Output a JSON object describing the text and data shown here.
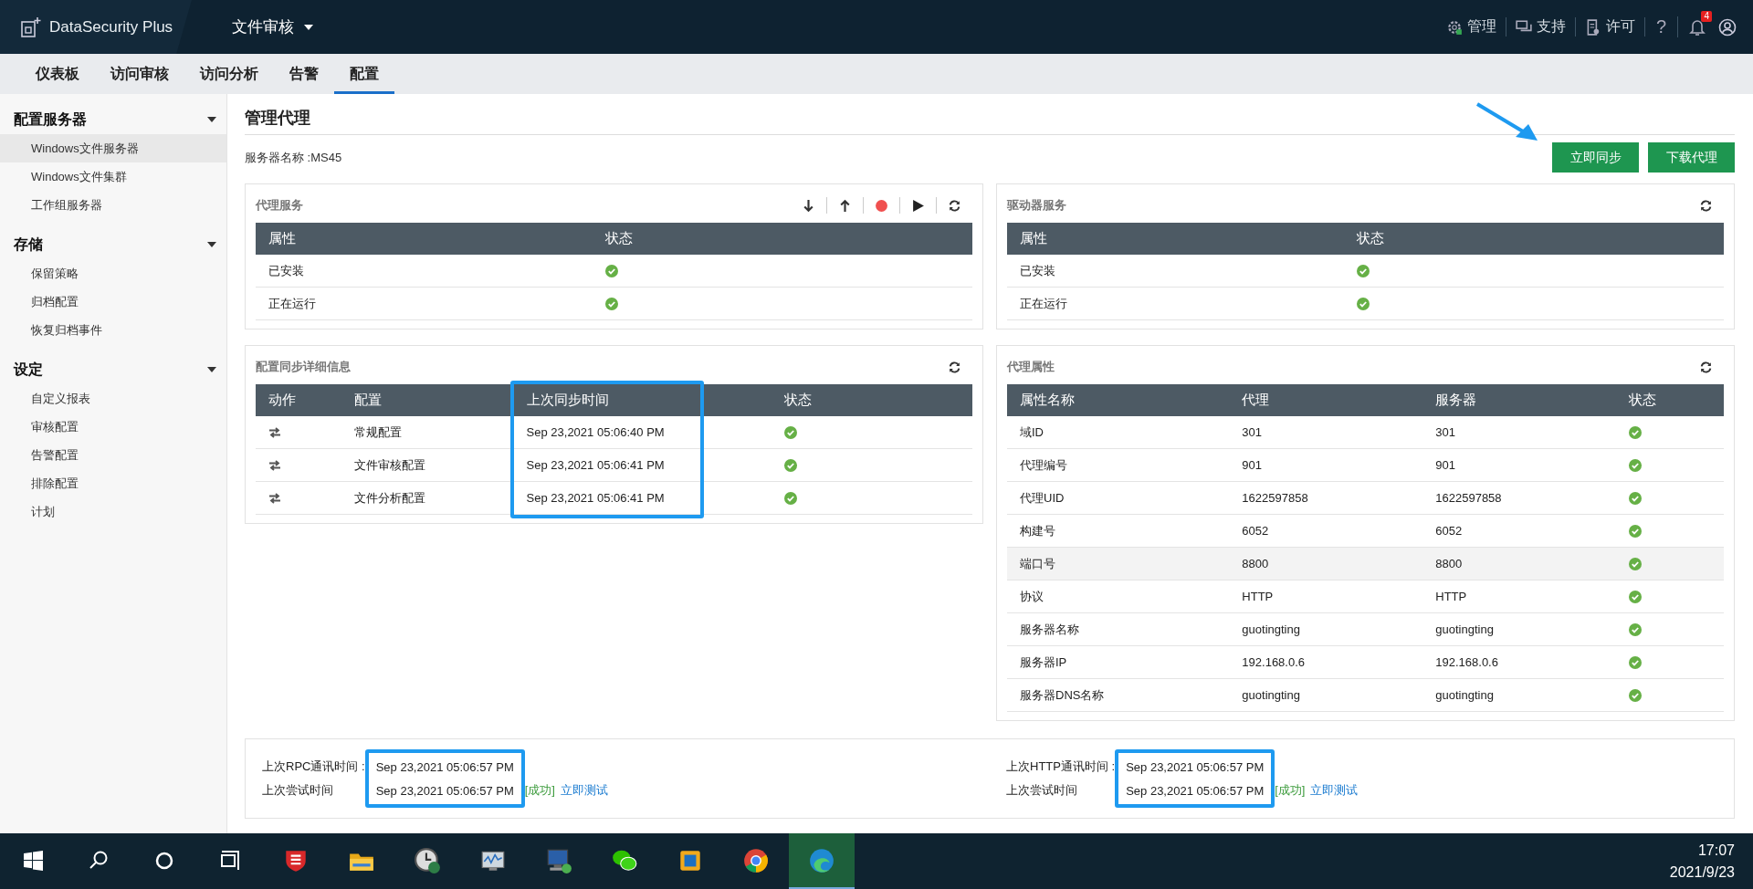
{
  "header": {
    "product": "DataSecurity Plus",
    "module": "文件审核",
    "links": [
      {
        "kind": "gear",
        "label": "管理"
      },
      {
        "kind": "chat",
        "label": "支持"
      },
      {
        "kind": "license",
        "label": "许可"
      }
    ],
    "help": "?",
    "notification_count": "4"
  },
  "tabs": [
    {
      "label": "仪表板",
      "selected": false
    },
    {
      "label": "访问审核",
      "selected": false
    },
    {
      "label": "访问分析",
      "selected": false
    },
    {
      "label": "告警",
      "selected": false
    },
    {
      "label": "配置",
      "selected": true
    }
  ],
  "sidebar": {
    "sections": [
      {
        "title": "配置服务器",
        "items": [
          {
            "label": "Windows文件服务器",
            "selected": true
          },
          {
            "label": "Windows文件集群",
            "selected": false
          },
          {
            "label": "工作组服务器",
            "selected": false
          }
        ]
      },
      {
        "title": "存储",
        "items": [
          {
            "label": "保留策略",
            "selected": false
          },
          {
            "label": "归档配置",
            "selected": false
          },
          {
            "label": "恢复归档事件",
            "selected": false
          }
        ]
      },
      {
        "title": "设定",
        "items": [
          {
            "label": "自定义报表",
            "selected": false
          },
          {
            "label": "审核配置",
            "selected": false
          },
          {
            "label": "告警配置",
            "selected": false
          },
          {
            "label": "排除配置",
            "selected": false
          },
          {
            "label": "计划",
            "selected": false
          }
        ]
      }
    ]
  },
  "page": {
    "title": "管理代理",
    "server_name": "服务器名称 :MS45",
    "buttons": [
      "立即同步",
      "下载代理"
    ]
  },
  "agent_service": {
    "title": "代理服务",
    "columns": [
      "属性",
      "状态"
    ],
    "rows": [
      {
        "name": "已安装",
        "ok": true
      },
      {
        "name": "正在运行",
        "ok": true
      }
    ]
  },
  "sync_details": {
    "title": "配置同步详细信息",
    "columns": [
      "动作",
      "配置",
      "上次同步时间",
      "状态"
    ],
    "rows": [
      {
        "config": "常规配置",
        "time": "Sep 23,2021 05:06:40 PM",
        "ok": true
      },
      {
        "config": "文件审核配置",
        "time": "Sep 23,2021 05:06:41 PM",
        "ok": true
      },
      {
        "config": "文件分析配置",
        "time": "Sep 23,2021 05:06:41 PM",
        "ok": true
      }
    ]
  },
  "driver_service": {
    "title": "驱动器服务",
    "columns": [
      "属性",
      "状态"
    ],
    "rows": [
      {
        "name": "已安装",
        "ok": true
      },
      {
        "name": "正在运行",
        "ok": true
      }
    ]
  },
  "agent_properties": {
    "title": "代理属性",
    "columns": [
      "属性名称",
      "代理",
      "服务器",
      "状态"
    ],
    "rows": [
      {
        "name": "域ID",
        "agent": "301",
        "server": "301",
        "ok": true,
        "selected": false
      },
      {
        "name": "代理编号",
        "agent": "901",
        "server": "901",
        "ok": true,
        "selected": false
      },
      {
        "name": "代理UID",
        "agent": "1622597858",
        "server": "1622597858",
        "ok": true,
        "selected": false
      },
      {
        "name": "构建号",
        "agent": "6052",
        "server": "6052",
        "ok": true,
        "selected": false
      },
      {
        "name": "端口号",
        "agent": "8800",
        "server": "8800",
        "ok": true,
        "selected": true
      },
      {
        "name": "协议",
        "agent": "HTTP",
        "server": "HTTP",
        "ok": true,
        "selected": false
      },
      {
        "name": "服务器名称",
        "agent": "guotingting",
        "server": "guotingting",
        "ok": true,
        "selected": false
      },
      {
        "name": "服务器IP",
        "agent": "192.168.0.6",
        "server": "192.168.0.6",
        "ok": true,
        "selected": false
      },
      {
        "name": "服务器DNS名称",
        "agent": "guotingting",
        "server": "guotingting",
        "ok": true,
        "selected": false
      }
    ]
  },
  "communication": [
    {
      "label": "上次RPC通讯时间 :",
      "time": "Sep 23,2021 05:06:57 PM",
      "attempt_label": "上次尝试时间",
      "attempt_time": "Sep 23,2021 05:06:57 PM",
      "result": "[成功]",
      "link": "立即测试"
    },
    {
      "label": "上次HTTP通讯时间 :",
      "time": "Sep 23,2021 05:06:57 PM",
      "attempt_label": "上次尝试时间",
      "attempt_time": "Sep 23,2021 05:06:57 PM",
      "result": "[成功]",
      "link": "立即测试"
    }
  ],
  "taskbar": {
    "apps": [
      {
        "kind": "shield",
        "selected": false
      },
      {
        "kind": "folder",
        "selected": false
      },
      {
        "kind": "clock",
        "selected": false
      },
      {
        "kind": "monitor",
        "selected": false
      },
      {
        "kind": "computer",
        "selected": false
      },
      {
        "kind": "chat",
        "selected": false
      },
      {
        "kind": "box",
        "selected": false
      },
      {
        "kind": "chrome",
        "selected": false
      },
      {
        "kind": "edge",
        "selected": true
      }
    ],
    "time": "17:07",
    "date": "2021/9/23"
  }
}
